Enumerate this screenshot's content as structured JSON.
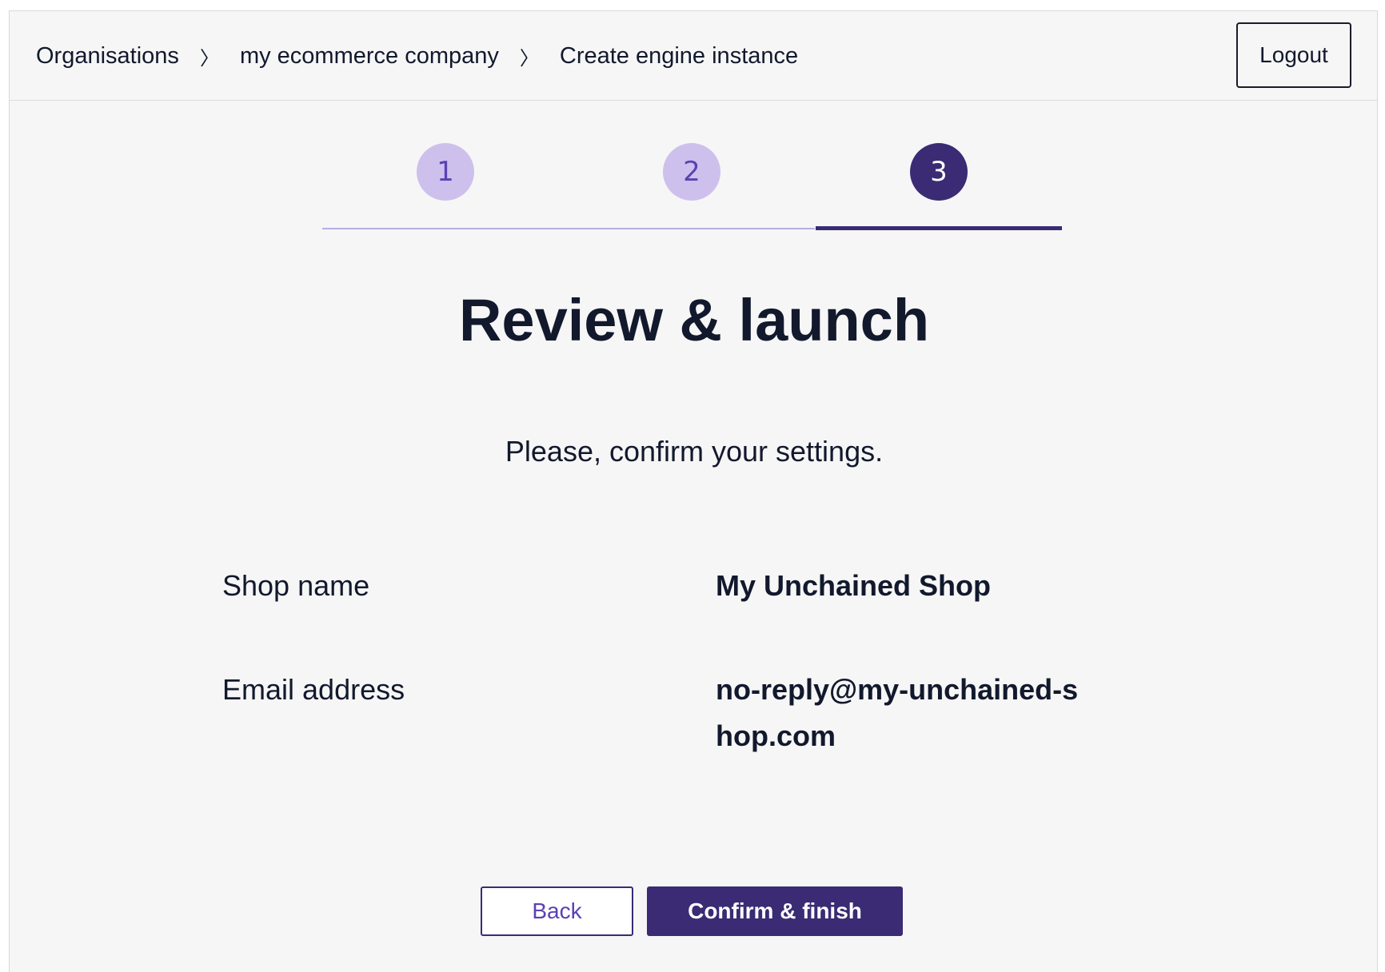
{
  "header": {
    "breadcrumb": [
      "Organisations",
      "my ecommerce company",
      "Create engine instance"
    ],
    "separator": "〉",
    "logout_label": "Logout"
  },
  "stepper": {
    "steps": [
      "1",
      "2",
      "3"
    ],
    "current_step": 3
  },
  "main": {
    "title": "Review & launch",
    "subtitle": "Please, confirm your settings.",
    "settings": [
      {
        "label": "Shop name",
        "value": "My Unchained Shop"
      },
      {
        "label": "Email address",
        "value": "no-reply@my-unchained-shop.com"
      }
    ]
  },
  "actions": {
    "back_label": "Back",
    "confirm_label": "Confirm & finish"
  },
  "colors": {
    "brand_primary": "#3a2b74",
    "step_inactive_bg": "#cec0ec",
    "step_inactive_text": "#5b41b4",
    "background": "#f6f6f6",
    "text": "#12192d"
  }
}
